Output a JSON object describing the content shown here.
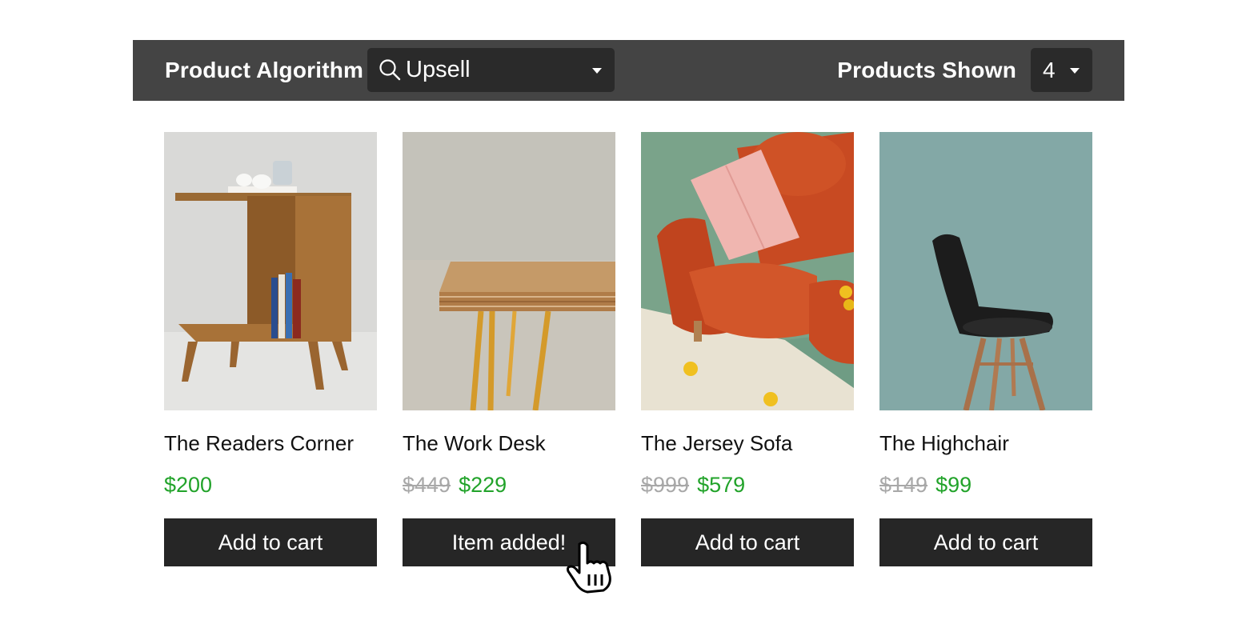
{
  "toolbar": {
    "algorithm_label": "Product Algorithm",
    "algorithm_value": "Upsell",
    "shown_label": "Products Shown",
    "shown_value": "4",
    "background": "#444444"
  },
  "products": [
    {
      "name": "The Readers Corner",
      "old_price": "",
      "price": "$200",
      "button": "Add to cart",
      "image": "wooden-side-table-photo"
    },
    {
      "name": "The Work Desk",
      "old_price": "$449",
      "price": "$229",
      "button": "Item added!",
      "image": "wooden-desk-photo"
    },
    {
      "name": "The Jersey Sofa",
      "old_price": "$999",
      "price": "$579",
      "button": "Add to cart",
      "image": "orange-sofa-photo"
    },
    {
      "name": "The Highchair",
      "old_price": "$149",
      "price": "$99",
      "button": "Add to cart",
      "image": "black-chair-photo"
    }
  ],
  "colors": {
    "price_green": "#22a32a",
    "button_dark": "#262626",
    "strike_grey": "#a8a8a8"
  },
  "icons": {
    "search": "search-icon",
    "dropdown": "chevron-down-icon",
    "cursor": "hand-pointer-icon"
  }
}
